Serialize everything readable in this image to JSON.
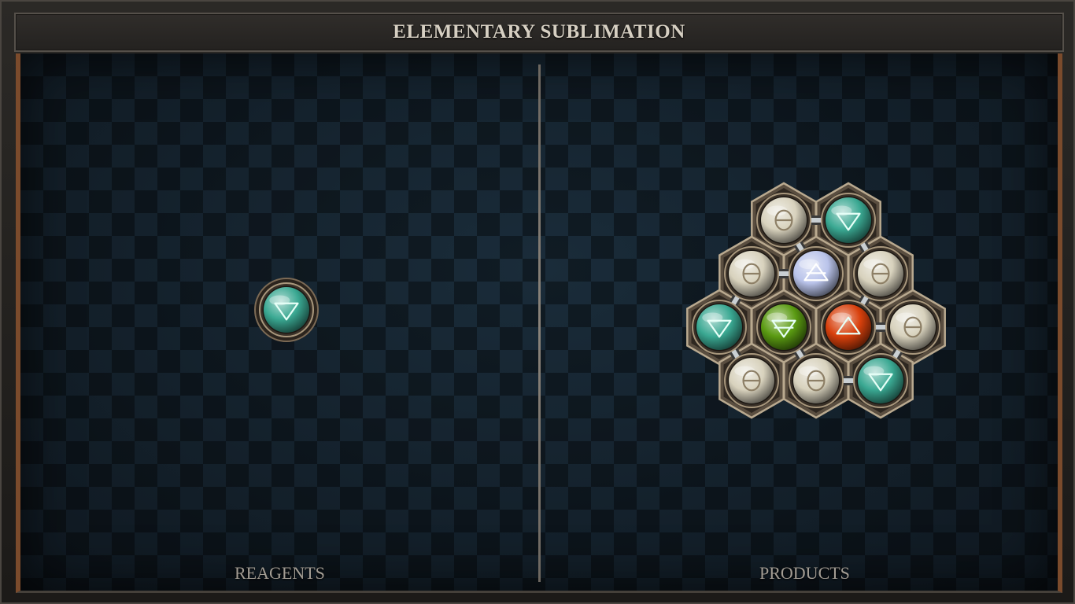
{
  "header": {
    "title": "ELEMENTARY SUBLIMATION"
  },
  "panels": {
    "reagents": {
      "label": "REAGENTS"
    },
    "products": {
      "label": "PRODUCTS"
    }
  },
  "reagent_atom": {
    "element": "water",
    "symbol": "water-triangle-icon"
  },
  "product_molecule": {
    "atoms": [
      {
        "id": "a1",
        "element": "salt"
      },
      {
        "id": "a2",
        "element": "water"
      },
      {
        "id": "a3",
        "element": "salt"
      },
      {
        "id": "a4",
        "element": "air"
      },
      {
        "id": "a5",
        "element": "salt"
      },
      {
        "id": "a6",
        "element": "water"
      },
      {
        "id": "a7",
        "element": "earth"
      },
      {
        "id": "a8",
        "element": "fire"
      },
      {
        "id": "a9",
        "element": "salt"
      },
      {
        "id": "a10",
        "element": "salt"
      },
      {
        "id": "a11",
        "element": "salt"
      },
      {
        "id": "a12",
        "element": "water"
      }
    ],
    "bonds": [
      [
        "a1",
        "a2"
      ],
      [
        "a1",
        "a4"
      ],
      [
        "a2",
        "a5"
      ],
      [
        "a3",
        "a4"
      ],
      [
        "a3",
        "a6"
      ],
      [
        "a5",
        "a8"
      ],
      [
        "a8",
        "a9"
      ],
      [
        "a6",
        "a10"
      ],
      [
        "a7",
        "a11"
      ],
      [
        "a9",
        "a12"
      ],
      [
        "a11",
        "a12"
      ]
    ]
  },
  "element_colors": {
    "salt": "#d8d2bd",
    "water": "#3aa892",
    "air": "#b9c3ea",
    "earth": "#5a9a12",
    "fire": "#d8400c",
    "frame_bronze": "#8a7a66",
    "accent_copper": "#7b4b2c"
  }
}
